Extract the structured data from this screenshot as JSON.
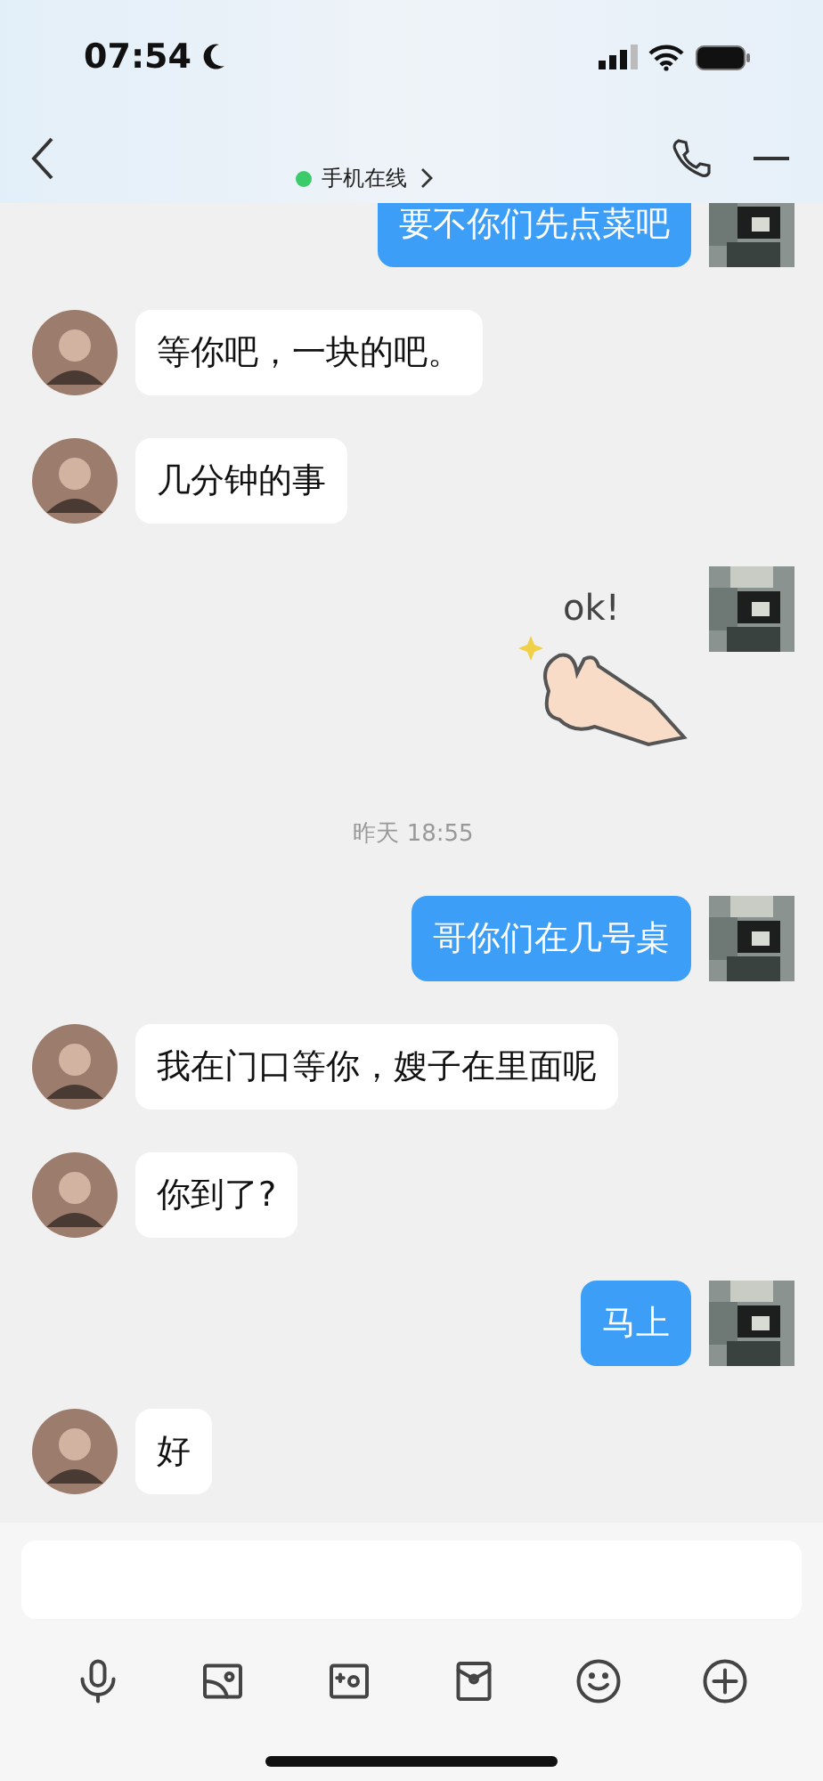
{
  "status_bar": {
    "time": "07:54"
  },
  "header": {
    "subtitle": "手机在线",
    "online": true
  },
  "messages": [
    {
      "kind": "text",
      "outgoing": true,
      "text": "要不你们先点菜吧"
    },
    {
      "kind": "text",
      "outgoing": false,
      "text": "等你吧，一块的吧。"
    },
    {
      "kind": "text",
      "outgoing": false,
      "text": "几分钟的事"
    },
    {
      "kind": "sticker",
      "outgoing": true,
      "text": "ok!"
    },
    {
      "kind": "time",
      "text": "昨天 18:55"
    },
    {
      "kind": "text",
      "outgoing": true,
      "text": "哥你们在几号桌"
    },
    {
      "kind": "text",
      "outgoing": false,
      "text": "我在门口等你，嫂子在里面呢"
    },
    {
      "kind": "text",
      "outgoing": false,
      "text": "你到了?"
    },
    {
      "kind": "text",
      "outgoing": true,
      "text": "马上"
    },
    {
      "kind": "text",
      "outgoing": false,
      "text": "好"
    }
  ],
  "composer": {
    "toolbar": [
      {
        "kind": "microphone"
      },
      {
        "kind": "image"
      },
      {
        "kind": "camera"
      },
      {
        "kind": "envelope"
      },
      {
        "kind": "emoji"
      },
      {
        "kind": "plus"
      }
    ]
  }
}
